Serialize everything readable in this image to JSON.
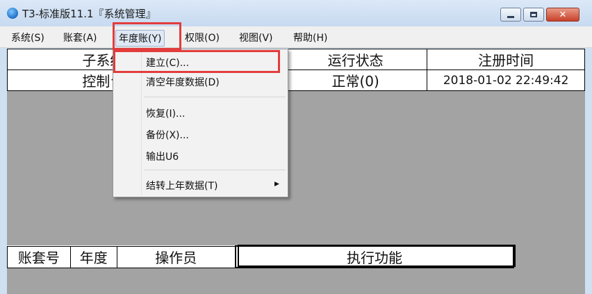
{
  "window": {
    "title": "T3-标准版11.1『系统管理』"
  },
  "menubar": {
    "items": [
      {
        "label": "系统(S)"
      },
      {
        "label": "账套(A)"
      },
      {
        "label": "年度账(Y)"
      },
      {
        "label": "权限(O)"
      },
      {
        "label": "视图(V)"
      },
      {
        "label": "帮助(H)"
      }
    ]
  },
  "dropdown": {
    "items": [
      {
        "label": "建立(C)..."
      },
      {
        "label": "清空年度数据(D)"
      },
      {
        "label": "恢复(I)..."
      },
      {
        "label": "备份(X)..."
      },
      {
        "label": "输出U6"
      },
      {
        "label": "结转上年数据(T)"
      }
    ],
    "submenu_arrow": "▶"
  },
  "subsystem_table": {
    "headers": [
      "子系统",
      "",
      "运行状态",
      "注册时间"
    ],
    "row": [
      "控制台",
      "",
      "正常(0)",
      "2018-01-02 22:49:42"
    ]
  },
  "task_table": {
    "headers": [
      "账套号",
      "年度",
      "操作员",
      "执行功能"
    ]
  },
  "colors": {
    "highlight_box": "#e23c3c",
    "workspace": "#a3a3a3"
  }
}
